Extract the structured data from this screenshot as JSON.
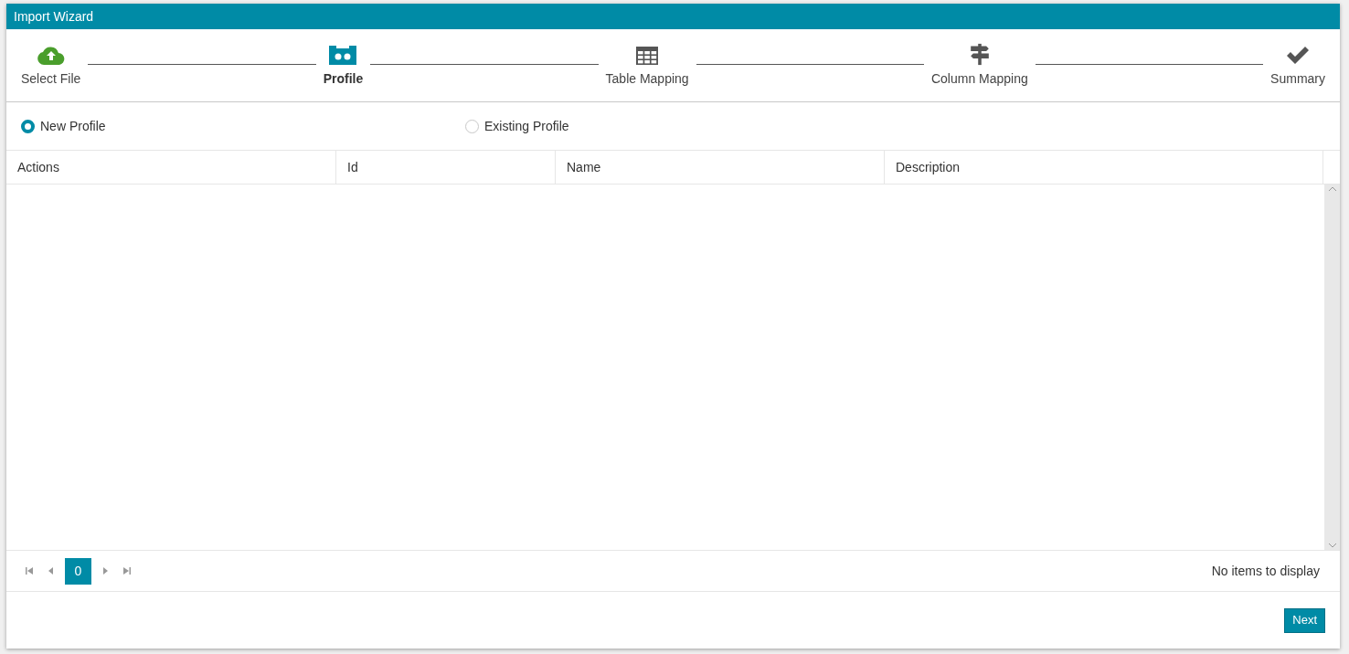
{
  "window": {
    "title": "Import Wizard"
  },
  "steps": [
    {
      "label": "Select File",
      "completed": true,
      "selected": false
    },
    {
      "label": "Profile",
      "completed": false,
      "selected": true
    },
    {
      "label": "Table Mapping",
      "completed": false,
      "selected": false
    },
    {
      "label": "Column Mapping",
      "completed": false,
      "selected": false
    },
    {
      "label": "Summary",
      "completed": false,
      "selected": false
    }
  ],
  "profile_options": [
    {
      "label": "New Profile",
      "selected": true
    },
    {
      "label": "Existing Profile",
      "selected": false
    }
  ],
  "table": {
    "columns": [
      "Actions",
      "Id",
      "Name",
      "Description"
    ]
  },
  "pager": {
    "page": "0",
    "status": "No items to display"
  },
  "buttons": [
    "Next"
  ]
}
